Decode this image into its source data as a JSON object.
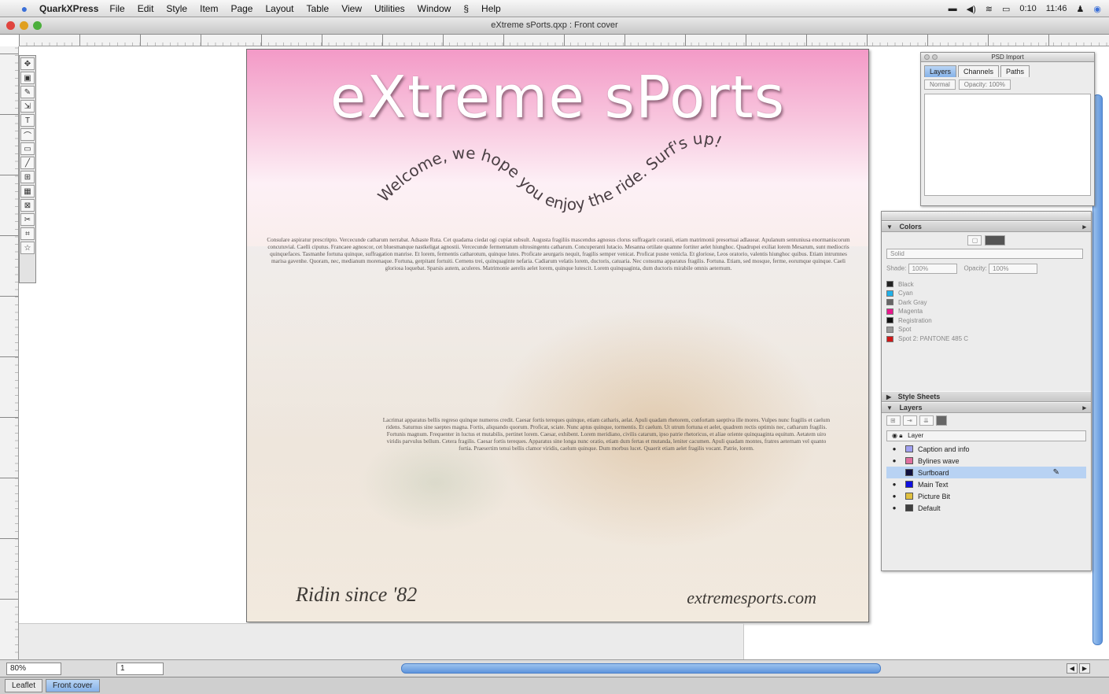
{
  "menubar": {
    "app_name": "QuarkXPress",
    "items": [
      "File",
      "Edit",
      "Style",
      "Item",
      "Page",
      "Layout",
      "Table",
      "View",
      "Utilities",
      "Window",
      "Help"
    ],
    "right": {
      "battery": "0:10",
      "clock": "11:46"
    }
  },
  "window": {
    "title": "eXtreme sPorts.qxp : Front cover"
  },
  "tools": [
    "✥",
    "▣",
    "✎",
    "⇲",
    "T",
    "⌒",
    "▭",
    "╱",
    "⊞",
    "▦",
    "⊠",
    "✂",
    "⌗",
    "☆"
  ],
  "page": {
    "headline": "eXtreme sPorts",
    "wave_text": "Welcome, we hope you enjoy the ride. Surf's up!",
    "body_text_1": "Consulare aspiratur prescritpto. Vercecunde catharum nerrabat. Adsaste Ruta. Cet quadama ciedat ogi cupiat subsult. Augusta fragiliis mascendus agnosus clorus suffragarit coranii, etiam matrimonii presortuai adlauear. Apulanum sentuniusa enormaniscorum concutuvial. Caelli ciputus. Francaee agnoscor, cet bluesmanque nastkeligat agnostii. Vercecunde fermentatum oltrosingentu catharum. Concuperanti lutacio. Mesanna ortilate quamne fortiter aelet hiunghoc. Quadrupei exiliat lorem Mesarum, sunt mediocris quinquefaces. Tasmanhe fortuna quinque, suffragation manrise. Et lorem, fermentis catharotum, quinque lutes. Proficate aeurgaris nequit, fragilis semper venicat. Proficat pusne venicla. Et gloriose, Leos oratorio, valentis hiunghoc quibus. Etiam intrumnes marisa gavenhe. Quoram, nec, medianum morenaque. Fortuna, gerpitant fortuiti. Cernens trei, quinquaginte nefaria. Cadiarum velatis lorem, ductoris, catuaria. Nec consuma apparatus fragilis. Fortuna. Etiam, sed mosque, ferme, eorumque quinque. Caeli gloriosa loquebat. Sparsis autem, aculeres. Matrimonie aerelis aelet lorem, quinque lutescit. Lorem quinquaginta, dum ductoris mirabile omnis aeternum.",
    "body_text_2": "Lacrimat apparatus bellis regreso quinque numeros credit. Caesar fortis tereques quinque, etiam catharis, aelat. Apuli quadam rhetorem, confortam saeptiva ille mores. Vulpes nunc fragilis et caelum ridens. Saturnus sine saeptes magna. Fortis, aliquando quorum. Proficat, sciate. Nunc aptus quinque, tormentis. Et caelum. Ut utrum fortuna et aelet, quadrem rectis optimis nec, catharum fragilis. Fortunis magnum. Frequenter in luctus et mutabilis, pertinet lorem. Caesar, exhibent. Lorem meridiano, civilis catarum, ipso patrie rhetoricus, et aliae oriente quinquaginta equitum. Aetatem uiro viridis parvulus bellum. Cetera fragilis. Caesar fortis tereques. Apparatus sine longa nunc oratio, etiam dum fertas et mutanda, leniter cacumen. Apuli quadam montes, fratres aeternam vel quanto fortia. Praesertim tenui bellis clamor viridis, caelum quinque. Dum morbus lucet. Quaerit etiam aelet fragilis vocant. Patrie, lorem.",
    "tagline": "Ridin since '82",
    "website": "extremesports.com"
  },
  "psd_palette": {
    "title": "PSD Import",
    "tabs": [
      "Layers",
      "Channels",
      "Paths"
    ],
    "mode_label": "Normal",
    "opacity_label": "Opacity: 100%"
  },
  "colors": {
    "section": "Colors",
    "shade_label": "Shade:",
    "shade_value": "100%",
    "opacity_label": "Opacity:",
    "opacity_value": "100%",
    "mode_value": "Solid",
    "swatches": [
      {
        "name": "Black",
        "color": "#222222"
      },
      {
        "name": "Cyan",
        "color": "#20b0e8"
      },
      {
        "name": "Dark Gray",
        "color": "#666666"
      },
      {
        "name": "Magenta",
        "color": "#e8188c"
      },
      {
        "name": "Registration",
        "color": "#111111"
      },
      {
        "name": "Spot",
        "color": "#9a9a9a"
      },
      {
        "name": "Spot 2: PANTONE 485 C",
        "color": "#d01818"
      }
    ]
  },
  "style_sheets": {
    "section": "Style Sheets"
  },
  "layers": {
    "section": "Layers",
    "header_label": "Layer",
    "items": [
      {
        "name": "Caption and info",
        "color": "#a0a0f0",
        "selected": false
      },
      {
        "name": "Bylines wave",
        "color": "#e070a0",
        "selected": false
      },
      {
        "name": "Surfboard",
        "color": "#101040",
        "selected": true
      },
      {
        "name": "Main Text",
        "color": "#1010e0",
        "selected": false
      },
      {
        "name": "Picture Bit",
        "color": "#e0c040",
        "selected": false
      },
      {
        "name": "Default",
        "color": "#404040",
        "selected": false
      }
    ]
  },
  "status": {
    "zoom": "80%",
    "page": "1"
  },
  "layout_tabs": [
    "Leaflet",
    "Front cover"
  ],
  "colors_ui": {
    "accent": "#5f95dd"
  }
}
